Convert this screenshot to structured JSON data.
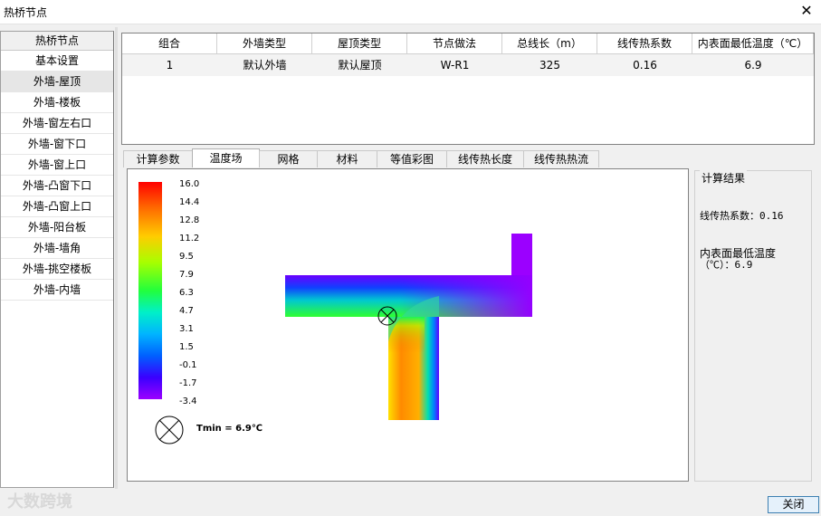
{
  "window": {
    "title": "热桥节点",
    "close_icon": "✕"
  },
  "sidebar": {
    "header": "热桥节点",
    "items": [
      {
        "label": "基本设置"
      },
      {
        "label": "外墙-屋顶",
        "selected": true
      },
      {
        "label": "外墙-楼板"
      },
      {
        "label": "外墙-窗左右口"
      },
      {
        "label": "外墙-窗下口"
      },
      {
        "label": "外墙-窗上口"
      },
      {
        "label": "外墙-凸窗下口"
      },
      {
        "label": "外墙-凸窗上口"
      },
      {
        "label": "外墙-阳台板"
      },
      {
        "label": "外墙-墙角"
      },
      {
        "label": "外墙-挑空楼板"
      },
      {
        "label": "外墙-内墙"
      }
    ]
  },
  "table": {
    "columns": [
      "组合",
      "外墙类型",
      "屋顶类型",
      "节点做法",
      "总线长（m）",
      "线传热系数",
      "内表面最低温度（℃）"
    ],
    "rows": [
      [
        "1",
        "默认外墙",
        "默认屋顶",
        "W-R1",
        "325",
        "0.16",
        "6.9"
      ]
    ]
  },
  "tabs": [
    {
      "label": "计算参数"
    },
    {
      "label": "温度场",
      "active": true
    },
    {
      "label": "网格"
    },
    {
      "label": "材料"
    },
    {
      "label": "等值彩图"
    },
    {
      "label": "线传热长度"
    },
    {
      "label": "线传热热流"
    }
  ],
  "colorbar": {
    "labels": [
      "16.0",
      "14.4",
      "12.8",
      "11.2",
      "9.5",
      "7.9",
      "6.3",
      "4.7",
      "3.1",
      "1.5",
      "-0.1",
      "-1.7",
      "-3.4"
    ]
  },
  "tmin_label": "Tmin = 6.9℃",
  "results": {
    "title": "计算结果",
    "psi_line": "线传热系数：0.16",
    "tmin_line1": "内表面最低温度",
    "tmin_line2": "（℃）：6.9"
  },
  "watermark": "大数跨境",
  "close_button": "关闭"
}
